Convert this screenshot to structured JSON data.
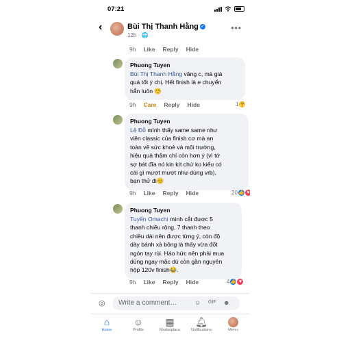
{
  "status": {
    "time": "07:21"
  },
  "header": {
    "name": "Bùi Thị Thanh Hằng",
    "sub": "12h",
    "back": "‹",
    "more": "•••"
  },
  "top_actions": {
    "time": "9h",
    "like": "Like",
    "reply": "Reply",
    "hide": "Hide"
  },
  "comments": [
    {
      "author": "Phuong Tuyen",
      "mention": "Bùi Thị Thanh Hằng",
      "lines": [
        " vâng c, mà giá",
        "quá tốt ý chị. Hết finish là e chuyển",
        "hẳn luôn ☺️"
      ],
      "reactions": "1",
      "actions": {
        "time": "9h",
        "care": "Care",
        "reply": "Reply",
        "hide": "Hide"
      }
    },
    {
      "author": "Phuong Tuyen",
      "mention": "Lệ Đỗ",
      "lines": [
        " mình thấy same same như",
        "viên classic của finish cơ mà an",
        "toàn về sức khoẻ và môi trường,",
        "hiệu quả thậm chí còn hơn ý (vì tớ",
        "sợ bát đĩa nó kin kít chứ ko kiểu có",
        "cái gì mượt mượt như dùng vrb),",
        "bạn thử đi😊"
      ],
      "reactions": "20",
      "actions": {
        "time": "9h",
        "like": "Like",
        "reply": "Reply",
        "hide": "Hide"
      }
    },
    {
      "author": "Phuong Tuyen",
      "mention": "Tuyển Omachi",
      "lines": [
        " mình cắt  được 5",
        "thanh chiều rộng, 7 thanh theo",
        "chiều dài nên được từng ý, còn độ",
        "dày bánh xà bông là thấy vừa đốt",
        "ngón tay rùi. Háo hức nên phải mua",
        "dùng ngay mặc dù còn gần nguyên",
        "hộp 120v finish😂."
      ],
      "reactions": "4",
      "actions": {
        "time": "9h",
        "like": "Like",
        "reply": "Reply",
        "hide": "Hide"
      }
    }
  ],
  "composer": {
    "placeholder": "Write a comment…"
  },
  "tabs": [
    {
      "label": "Home",
      "icon": "home-icon"
    },
    {
      "label": "Profile",
      "icon": "profile-icon"
    },
    {
      "label": "Marketplace",
      "icon": "marketplace-icon"
    },
    {
      "label": "Notifications",
      "icon": "bell-icon"
    },
    {
      "label": "Menu",
      "icon": "avatar"
    }
  ],
  "colors": {
    "accent": "#1877f2",
    "bubble": "#f0f2f5",
    "mention": "#385898",
    "care": "#c08a13"
  }
}
